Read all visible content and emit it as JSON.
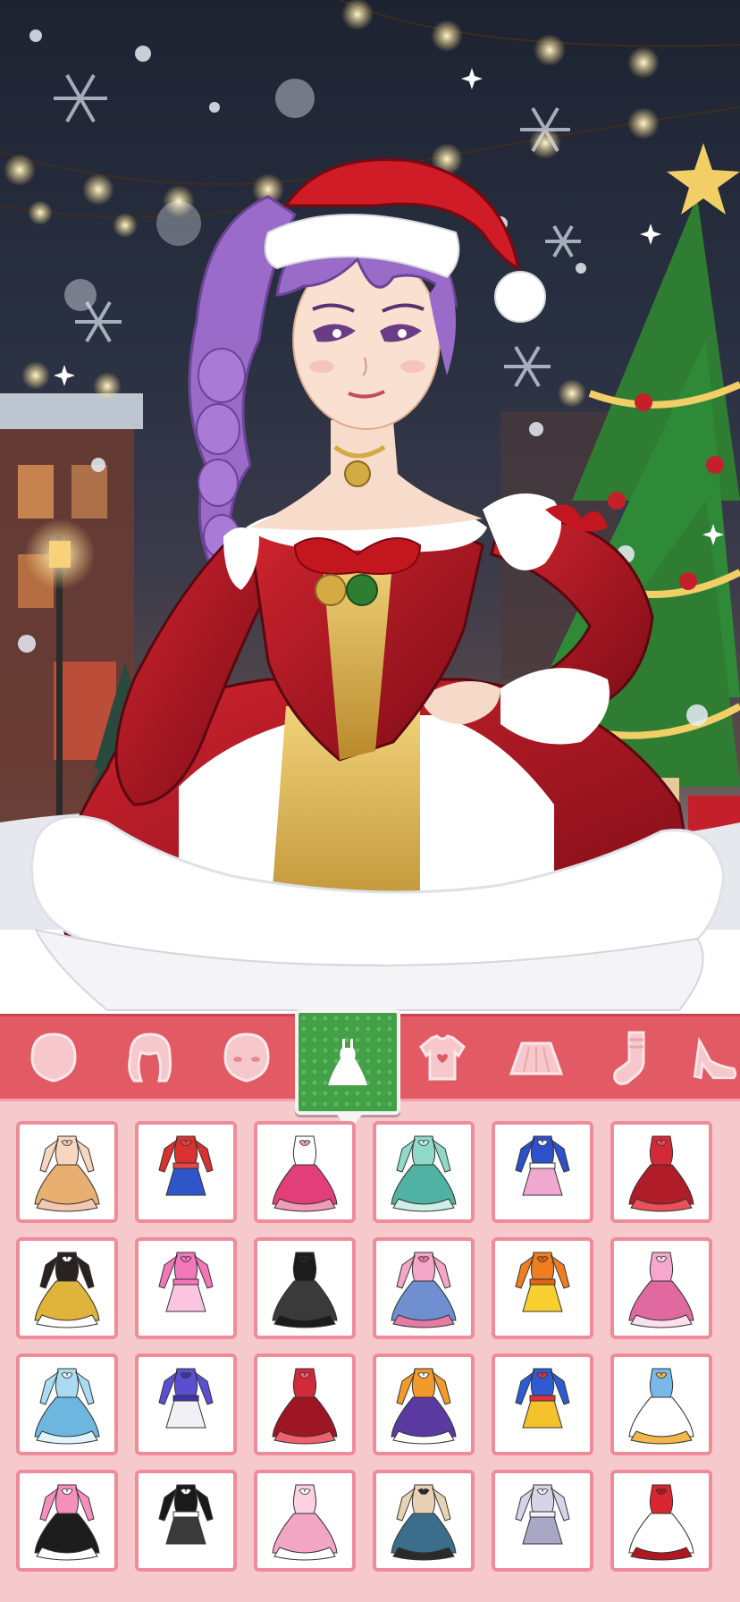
{
  "scene": {
    "character_name": "",
    "outfit": "santa-dress",
    "hair_color": "#9b6bc9",
    "accent_colors": {
      "red": "#b3141f",
      "gold": "#d4aa44",
      "white": "#ffffff",
      "tree": "#2f7d32"
    }
  },
  "categories": [
    {
      "id": "face",
      "icon": "face-shape-icon",
      "active": false
    },
    {
      "id": "hair",
      "icon": "hair-icon",
      "active": false
    },
    {
      "id": "eyes",
      "icon": "face-features-icon",
      "active": false
    },
    {
      "id": "dress",
      "icon": "dress-icon",
      "active": true
    },
    {
      "id": "top",
      "icon": "shirt-icon",
      "active": false
    },
    {
      "id": "skirt",
      "icon": "skirt-icon",
      "active": false
    },
    {
      "id": "socks",
      "icon": "sock-icon",
      "active": false
    },
    {
      "id": "shoes",
      "icon": "heel-shoe-icon",
      "active": false
    }
  ],
  "outfits": [
    {
      "name": "peach-angel-dress",
      "colors": [
        "#f7d6c0",
        "#e8b070",
        "#f3c9b3"
      ]
    },
    {
      "name": "red-blue-jacket-shorts",
      "colors": [
        "#d8312f",
        "#2f56c9",
        "#e8474a"
      ]
    },
    {
      "name": "pink-ruffle-skirt-set",
      "colors": [
        "#ffffff",
        "#e23e78",
        "#f09bb8"
      ]
    },
    {
      "name": "mint-check-dress",
      "colors": [
        "#8fd9c8",
        "#4fb2a2",
        "#cfeee5"
      ]
    },
    {
      "name": "blue-vest-plaid-skirt",
      "colors": [
        "#2e50c8",
        "#f0a8d0",
        "#ffffff"
      ]
    },
    {
      "name": "red-tiered-dress",
      "colors": [
        "#d42a37",
        "#b01c28",
        "#e9505a"
      ]
    },
    {
      "name": "black-gold-coat-dress",
      "colors": [
        "#2a2222",
        "#e0b43a",
        "#ffffff"
      ]
    },
    {
      "name": "pink-gingham-dress",
      "colors": [
        "#f277b8",
        "#fbc4e0",
        "#f277b8"
      ]
    },
    {
      "name": "black-lace-gown",
      "colors": [
        "#1c1c1c",
        "#3a3a3a",
        "#1c1c1c"
      ]
    },
    {
      "name": "pink-blouse-denim-skirt",
      "colors": [
        "#f4a6c6",
        "#6f8fd0",
        "#e57aa5"
      ]
    },
    {
      "name": "orange-pinafore-dress",
      "colors": [
        "#f07d1f",
        "#f8d030",
        "#e06515"
      ]
    },
    {
      "name": "pink-bow-dress",
      "colors": [
        "#f6a8cc",
        "#e06aa0",
        "#fbe0ed"
      ]
    },
    {
      "name": "icy-blue-ballgown",
      "colors": [
        "#a9dcf2",
        "#6cb6e0",
        "#e2f4fb"
      ]
    },
    {
      "name": "purple-jacket-white-skirt",
      "colors": [
        "#5a4fd0",
        "#f0f0f5",
        "#3c34a8"
      ]
    },
    {
      "name": "red-rose-gown",
      "colors": [
        "#d12a3a",
        "#9e1624",
        "#f0606e"
      ]
    },
    {
      "name": "orange-purple-idol-dress",
      "colors": [
        "#f39a2c",
        "#5a3aa0",
        "#ffffff"
      ]
    },
    {
      "name": "blue-yellow-magical-dress",
      "colors": [
        "#2f5bd0",
        "#f4c22c",
        "#e0303a"
      ]
    },
    {
      "name": "blue-white-lolita-dress",
      "colors": [
        "#7ab8ea",
        "#ffffff",
        "#f2b64a"
      ]
    },
    {
      "name": "pink-top-black-skirt",
      "colors": [
        "#f590bd",
        "#1c1c1c",
        "#ffffff"
      ]
    },
    {
      "name": "black-leather-jacket-set",
      "colors": [
        "#1a1a1a",
        "#3a3a3a",
        "#ffffff"
      ]
    },
    {
      "name": "pastel-pink-frill-dress",
      "colors": [
        "#fbd0e0",
        "#f3a6c4",
        "#ffffff"
      ]
    },
    {
      "name": "teal-cream-dress",
      "colors": [
        "#e9d2b4",
        "#3b6e8a",
        "#2a2a2a"
      ]
    },
    {
      "name": "silver-satin-dress",
      "colors": [
        "#d6d4e6",
        "#a9a6c6",
        "#f2f0fa"
      ]
    },
    {
      "name": "red-white-ruffle-dress",
      "colors": [
        "#d9262f",
        "#ffffff",
        "#b01820"
      ]
    }
  ]
}
